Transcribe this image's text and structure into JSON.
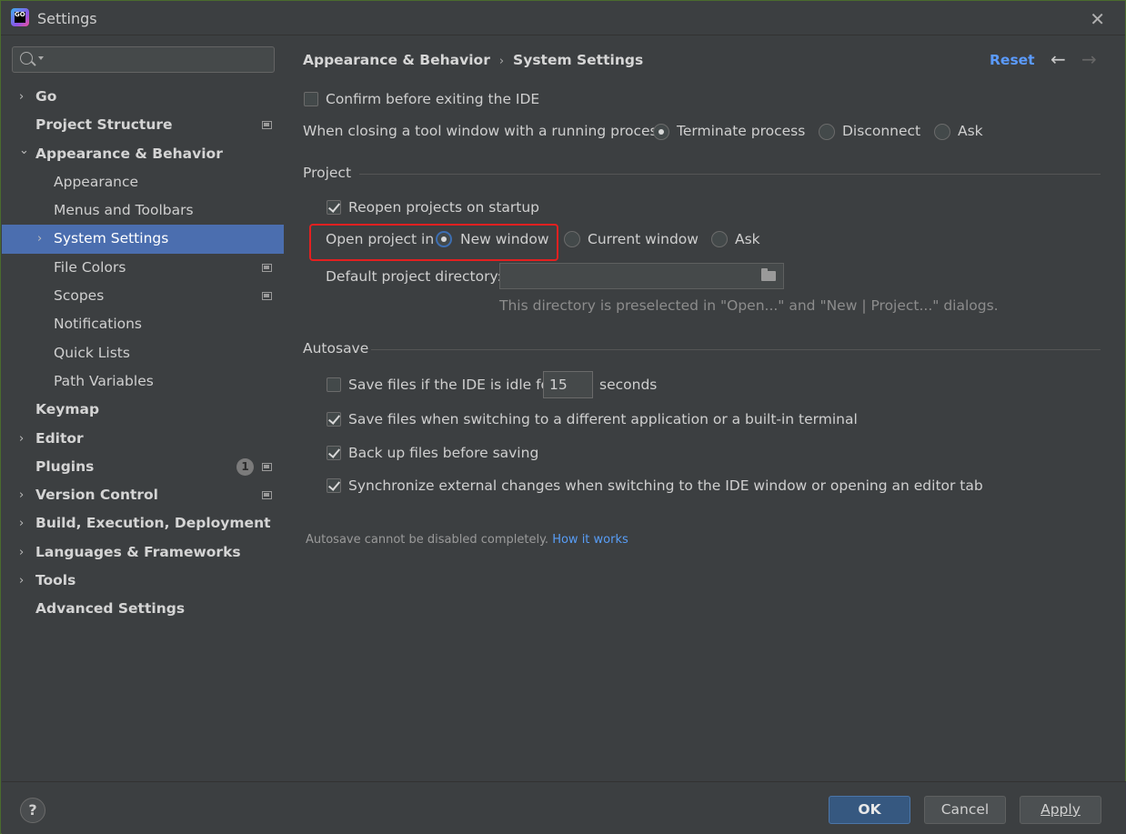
{
  "window": {
    "title": "Settings",
    "app_logo": "GO"
  },
  "search": {
    "placeholder": ""
  },
  "sidebar": {
    "items": [
      {
        "label": "Go",
        "level": 0,
        "arrow": "›"
      },
      {
        "label": "Project Structure",
        "level": 0,
        "arrow": "",
        "project_icon": true
      },
      {
        "label": "Appearance & Behavior",
        "level": 0,
        "arrow": "⌄"
      },
      {
        "label": "Appearance",
        "level": 1,
        "arrow": ""
      },
      {
        "label": "Menus and Toolbars",
        "level": 1,
        "arrow": ""
      },
      {
        "label": "System Settings",
        "level": 1,
        "arrow": "›",
        "selected": true
      },
      {
        "label": "File Colors",
        "level": 1,
        "arrow": "",
        "project_icon": true
      },
      {
        "label": "Scopes",
        "level": 1,
        "arrow": "",
        "project_icon": true
      },
      {
        "label": "Notifications",
        "level": 1,
        "arrow": ""
      },
      {
        "label": "Quick Lists",
        "level": 1,
        "arrow": ""
      },
      {
        "label": "Path Variables",
        "level": 1,
        "arrow": ""
      },
      {
        "label": "Keymap",
        "level": 0,
        "arrow": ""
      },
      {
        "label": "Editor",
        "level": 0,
        "arrow": "›"
      },
      {
        "label": "Plugins",
        "level": 0,
        "arrow": "",
        "badge": "1",
        "project_icon": true
      },
      {
        "label": "Version Control",
        "level": 0,
        "arrow": "›",
        "project_icon": true
      },
      {
        "label": "Build, Execution, Deployment",
        "level": 0,
        "arrow": "›"
      },
      {
        "label": "Languages & Frameworks",
        "level": 0,
        "arrow": "›"
      },
      {
        "label": "Tools",
        "level": 0,
        "arrow": "›"
      },
      {
        "label": "Advanced Settings",
        "level": 0,
        "arrow": ""
      }
    ]
  },
  "header": {
    "breadcrumb_parent": "Appearance & Behavior",
    "breadcrumb_sep": "›",
    "breadcrumb_current": "System Settings",
    "reset": "Reset",
    "back_glyph": "←",
    "forward_glyph": "→"
  },
  "general": {
    "confirm_exit": {
      "label": "Confirm before exiting the IDE",
      "checked": false
    },
    "closing_label": "When closing a tool window with a running process:",
    "closing_options": [
      "Terminate process",
      "Disconnect",
      "Ask"
    ],
    "closing_selected": "Terminate process"
  },
  "project": {
    "section": "Project",
    "reopen": {
      "label": "Reopen projects on startup",
      "checked": true
    },
    "open_in_label": "Open project in",
    "open_in_options": [
      "New window",
      "Current window",
      "Ask"
    ],
    "open_in_selected": "New window",
    "default_dir_label": "Default project directory:",
    "default_dir_value": "",
    "default_dir_hint": "This directory is preselected in \"Open...\" and \"New | Project...\" dialogs."
  },
  "autosave": {
    "section": "Autosave",
    "idle_label": "Save files if the IDE is idle for",
    "idle_value": "15",
    "idle_unit": "seconds",
    "idle_checked": false,
    "switch_app": {
      "label": "Save files when switching to a different application or a built-in terminal",
      "checked": true
    },
    "backup": {
      "label": "Back up files before saving",
      "checked": true
    },
    "sync": {
      "label": "Synchronize external changes when switching to the IDE window or opening an editor tab",
      "checked": true
    },
    "note": "Autosave cannot be disabled completely.",
    "note_link": "How it works"
  },
  "footer": {
    "help": "?",
    "ok": "OK",
    "cancel": "Cancel",
    "apply": "Apply"
  },
  "colors": {
    "accent": "#4b6eaf",
    "link": "#589df6",
    "highlight": "#e32020"
  }
}
